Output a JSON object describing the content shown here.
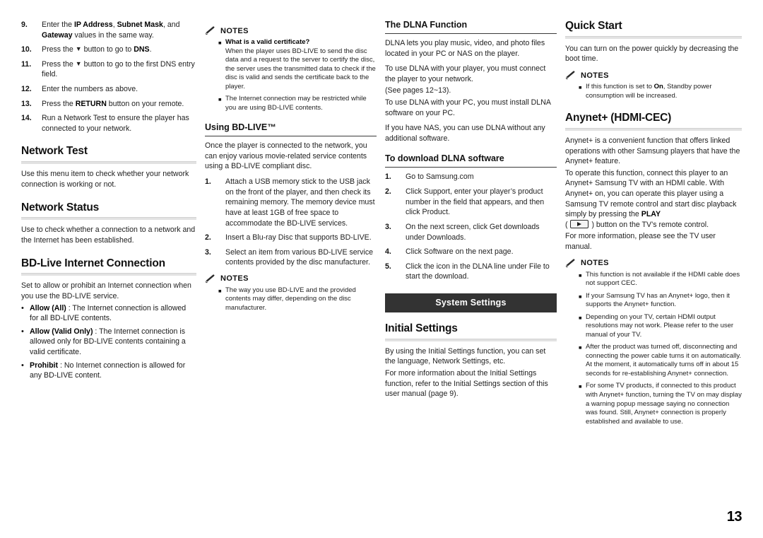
{
  "page": {
    "number": "13"
  },
  "icons": {
    "notes": "pencil-icon",
    "play_key": "play-button-icon",
    "down_arrow": "▼"
  },
  "colors": {
    "banner_bg": "#333333",
    "banner_text": "#ffffff",
    "h2_rule": "#e2e2e2",
    "h3_rule": "#3a3a3a"
  },
  "notes_label": "NOTES",
  "column1": {
    "steps": [
      {
        "num": "9.",
        "text_parts": [
          {
            "t": "Enter the ",
            "b": false
          },
          {
            "t": "IP Address",
            "b": true
          },
          {
            "t": ", ",
            "b": false
          },
          {
            "t": "Subnet Mask",
            "b": true
          },
          {
            "t": ", and ",
            "b": false
          },
          {
            "t": "Gateway",
            "b": true
          },
          {
            "t": " values in the same way.",
            "b": false
          }
        ]
      },
      {
        "num": "10.",
        "text_parts": [
          {
            "t": "Press the ▼ button to go to ",
            "b": false
          },
          {
            "t": "DNS",
            "b": true
          },
          {
            "t": ".",
            "b": false
          }
        ]
      },
      {
        "num": "11.",
        "text_parts": [
          {
            "t": "Press the ▼ button to go to the first DNS entry field.",
            "b": false
          }
        ]
      },
      {
        "num": "12.",
        "text_parts": [
          {
            "t": "Enter the numbers as above.",
            "b": false
          }
        ]
      },
      {
        "num": "13.",
        "text_parts": [
          {
            "t": "Press the ",
            "b": false
          },
          {
            "t": "RETURN",
            "b": true
          },
          {
            "t": " button on your remote.",
            "b": false
          }
        ]
      },
      {
        "num": "14.",
        "text_parts": [
          {
            "t": "Run a Network Test to ensure the player has connected to your network.",
            "b": false
          }
        ]
      }
    ],
    "network_test": {
      "heading": "Network Test",
      "body": "Use this menu item to check whether your network connection is working or not."
    },
    "network_status": {
      "heading": "Network Status",
      "body": "Use to check whether a connection to a network and the Internet has been established."
    },
    "bd_live": {
      "heading": "BD-Live Internet Connection",
      "body": "Set to allow or prohibit an Internet connection when you use the BD-LIVE service.",
      "options": [
        {
          "term": "Allow (All)",
          "desc": " : The Internet connection is allowed for all BD-LIVE contents."
        },
        {
          "term": "Allow (Valid Only)",
          "desc": " : The Internet connection is allowed only for BD-LIVE contents containing a valid certificate."
        },
        {
          "term": "Prohibit",
          "desc": " : No Internet connection is allowed for any BD-LIVE content."
        }
      ]
    }
  },
  "column2": {
    "notes_top": [
      {
        "bold_lead": "What is a valid certificate?",
        "text": "When the player uses BD-LIVE to send the disc data and a request to the server to certify the disc, the server uses the transmitted data to check if the disc is valid and sends the certificate back to the player."
      },
      {
        "bold_lead": "",
        "text": "The Internet connection may be restricted while you are using BD-LIVE contents."
      }
    ],
    "using_bdlive": {
      "heading": "Using BD-LIVE™",
      "body": "Once the player is connected to the network, you can enjoy various movie-related service contents using a BD-LIVE compliant disc.",
      "steps": [
        {
          "num": "1.",
          "text": "Attach a USB memory stick to the USB jack on the front of the player, and then check its remaining memory. The memory device must have at least 1GB of free space to accommodate the BD-LIVE services."
        },
        {
          "num": "2.",
          "text": "Insert a Blu-ray Disc that supports BD-LIVE."
        },
        {
          "num": "3.",
          "text": "Select an item from various BD-LIVE service contents provided by the disc manufacturer."
        }
      ],
      "notes": [
        {
          "bold_lead": "",
          "text": "The way you use BD-LIVE and the provided contents may differ, depending on the disc manufacturer."
        }
      ]
    }
  },
  "column3": {
    "dlna": {
      "heading": "The DLNA Function",
      "paragraphs": [
        "DLNA lets you play music, video, and photo files located in your PC or NAS on the player.",
        "To use DLNA with your player, you must connect the player to your network.",
        "(See pages 12~13).",
        "To use DLNA with your PC, you must install DLNA software on your PC.",
        "If you have NAS, you can use DLNA without any additional software."
      ]
    },
    "download_dlna": {
      "heading": "To download DLNA software",
      "steps": [
        {
          "num": "1.",
          "text": "Go to Samsung.com"
        },
        {
          "num": "2.",
          "text": "Click Support, enter your player’s product number in the field that appears, and then click Product."
        },
        {
          "num": "3.",
          "text": "On the next screen, click Get downloads under Downloads."
        },
        {
          "num": "4.",
          "text": "Click Software on the next page."
        },
        {
          "num": "5.",
          "text": "Click the icon in the DLNA line under File to start the download."
        }
      ]
    },
    "banner": "System Settings",
    "initial_settings": {
      "heading": "Initial Settings",
      "paragraphs": [
        "By using the Initial Settings function, you can set the language, Network Settings, etc.",
        "For more information about the Initial Settings function, refer to the Initial Settings section of this user manual (page 9)."
      ]
    }
  },
  "column4": {
    "quick_start": {
      "heading": "Quick Start",
      "body": "You can turn on the power quickly by decreasing the boot time.",
      "notes": [
        {
          "pre": "If this function is set to ",
          "bold": "On",
          "post": ", Standby power consumption will be increased."
        }
      ]
    },
    "anynet": {
      "heading": "Anynet+ (HDMI-CEC)",
      "paragraphs": [
        "Anynet+ is a convenient function that offers linked operations with other Samsung players that have the Anynet+ feature.",
        "To operate this function, connect this player to an Anynet+ Samsung TV with an HDMI cable. With Anynet+ on, you can operate this player using a Samsung TV remote control and start disc playback simply by pressing the PLAY",
        "For more information, please see the TV user manual."
      ],
      "play_line_prefix": "disc playback simply by pressing the ",
      "play_bold": "PLAY",
      "play_line_suffix": ") button on the TV’s remote control.",
      "notes": [
        {
          "text": "This function is not available if the HDMI cable does not support CEC."
        },
        {
          "text": "If your Samsung TV has an Anynet+ logo, then it supports the Anynet+ function."
        },
        {
          "text": "Depending on your TV, certain HDMI output resolutions may not work. Please refer to the user manual of your TV."
        },
        {
          "text": "After the product was turned off, disconnecting and connecting the power cable turns it on automatically. At the moment, it automatically turns off in about 15 seconds for re-establishing Anynet+ connection."
        },
        {
          "text": "For some TV products, if connected to this product with Anynet+ function, turning the TV on may display a warning popup message saying no connection was found. Still, Anynet+ connection is properly established and available to use."
        }
      ]
    }
  }
}
